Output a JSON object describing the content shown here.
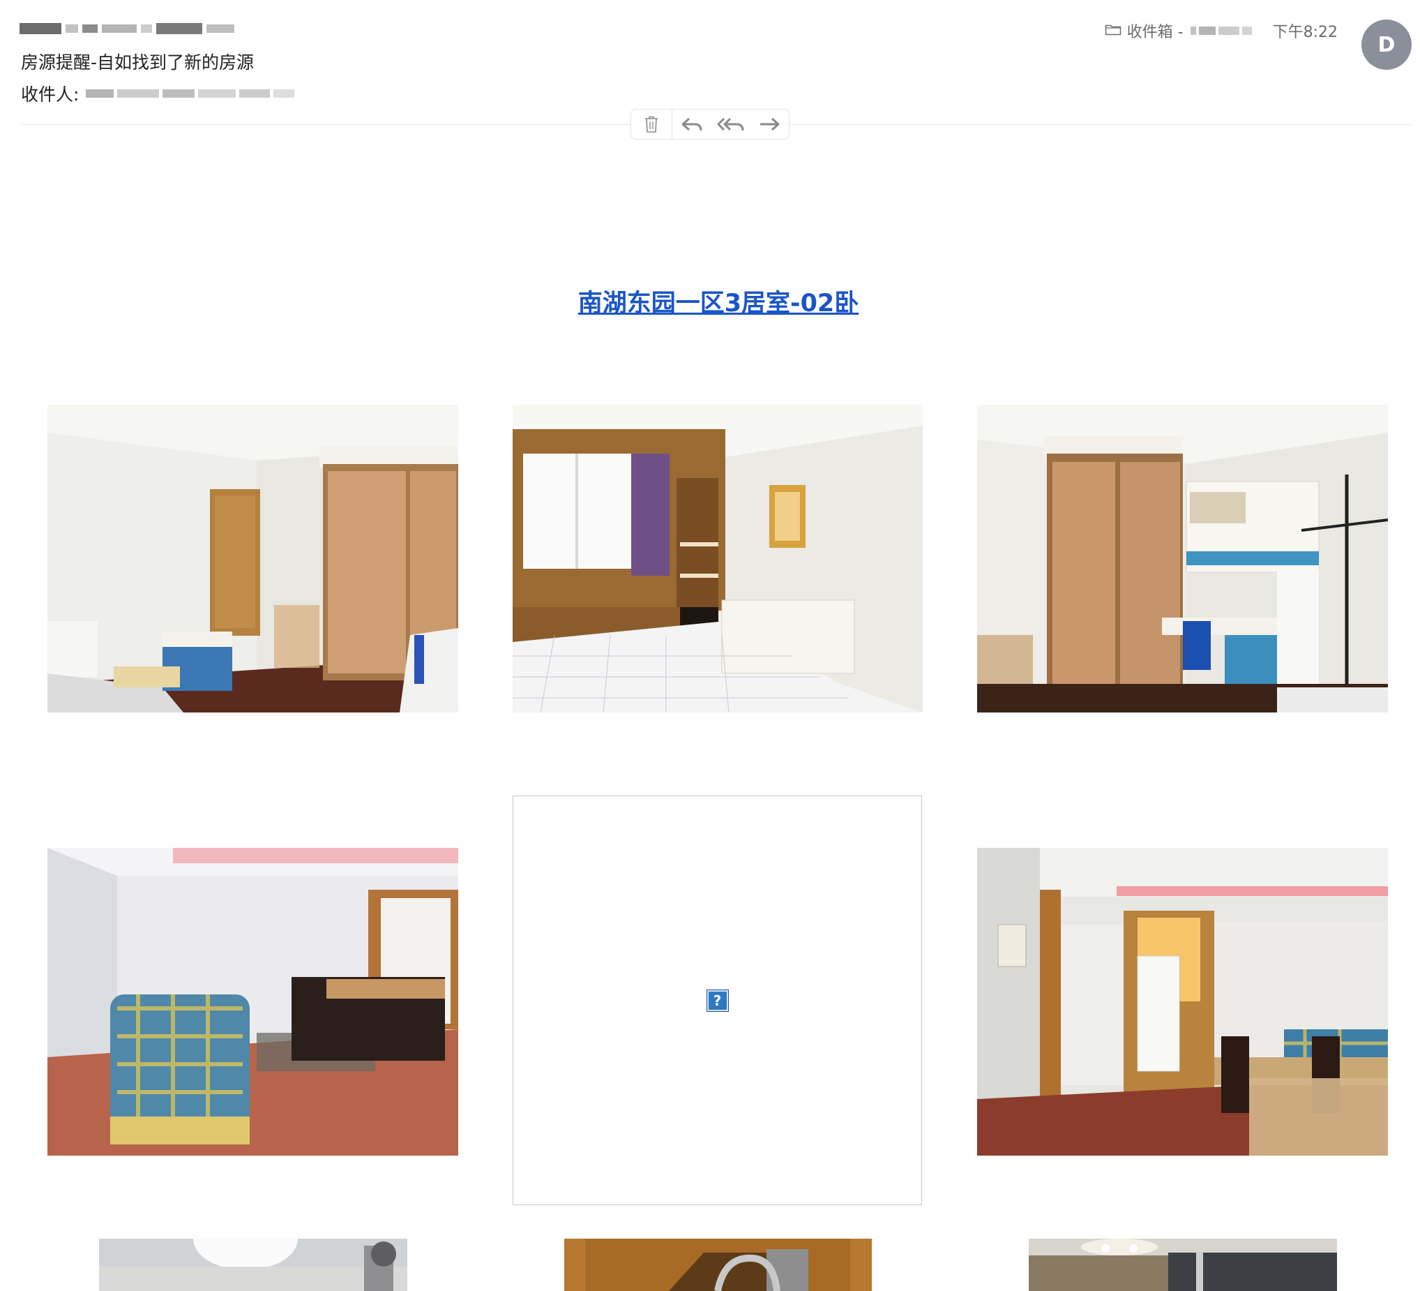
{
  "email": {
    "subject": "房源提醒-自如找到了新的房源",
    "recipients_label": "收件人:",
    "folder": "收件箱 -",
    "time": "下午8:22",
    "avatar_initial": "D"
  },
  "toolbar": {
    "icons": [
      "trash-icon",
      "reply-icon",
      "reply-all-icon",
      "forward-icon"
    ]
  },
  "listing": {
    "title": "南湖东园一区3居室-02卧"
  },
  "gallery": {
    "photos": [
      {
        "name": "bedroom-photo-1",
        "description": ""
      },
      {
        "name": "bedroom-photo-2",
        "description": ""
      },
      {
        "name": "bedroom-photo-3",
        "description": ""
      },
      {
        "name": "living-room-photo-1",
        "description": ""
      },
      {
        "name": "broken-image",
        "description": ""
      },
      {
        "name": "living-room-photo-2",
        "description": ""
      },
      {
        "name": "bathroom-photo-1",
        "description": ""
      },
      {
        "name": "bathroom-photo-2",
        "description": ""
      },
      {
        "name": "kitchen-photo",
        "description": ""
      }
    ],
    "broken_image_glyph": "?"
  },
  "colors": {
    "link": "#1a55c6",
    "avatar": "#8a8f9a",
    "broken_icon": "#2f78c2"
  }
}
